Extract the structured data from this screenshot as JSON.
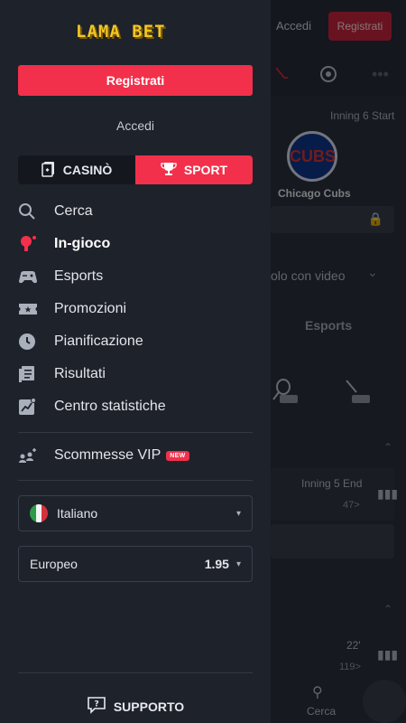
{
  "background": {
    "accedi": "Accedi",
    "registrati": "Registrati",
    "inning6": "Inning 6 Start",
    "team_logo": "CUBS",
    "team_name": "Chicago Cubs",
    "video_text": "olo con video",
    "esports": "Esports",
    "inning5": "Inning 5 End",
    "count47": "47>",
    "count22": "22'",
    "count119": "119>",
    "cerca": "Cerca"
  },
  "drawer": {
    "brand": "LAMA BET",
    "register_label": "Registrati",
    "login_label": "Accedi",
    "switch": {
      "casino": "CASINÒ",
      "sport": "SPORT"
    },
    "menu": [
      {
        "label": "Cerca",
        "icon": "search-icon"
      },
      {
        "label": "In-gioco",
        "icon": "live-mic-icon",
        "active": true
      },
      {
        "label": "Esports",
        "icon": "gamepad-icon"
      },
      {
        "label": "Promozioni",
        "icon": "ticket-icon"
      },
      {
        "label": "Pianificazione",
        "icon": "clock-icon"
      },
      {
        "label": "Risultati",
        "icon": "results-icon"
      },
      {
        "label": "Centro statistiche",
        "icon": "stats-icon"
      }
    ],
    "vip": {
      "label": "Scommesse VIP",
      "badge": "NEW"
    },
    "language": "Italiano",
    "odds_format": {
      "label": "Europeo",
      "value": "1.95"
    },
    "support": "SUPPORTO"
  },
  "colors": {
    "accent": "#f2304b",
    "drawer_bg": "#1e222b",
    "brand_yellow": "#f3c623"
  }
}
